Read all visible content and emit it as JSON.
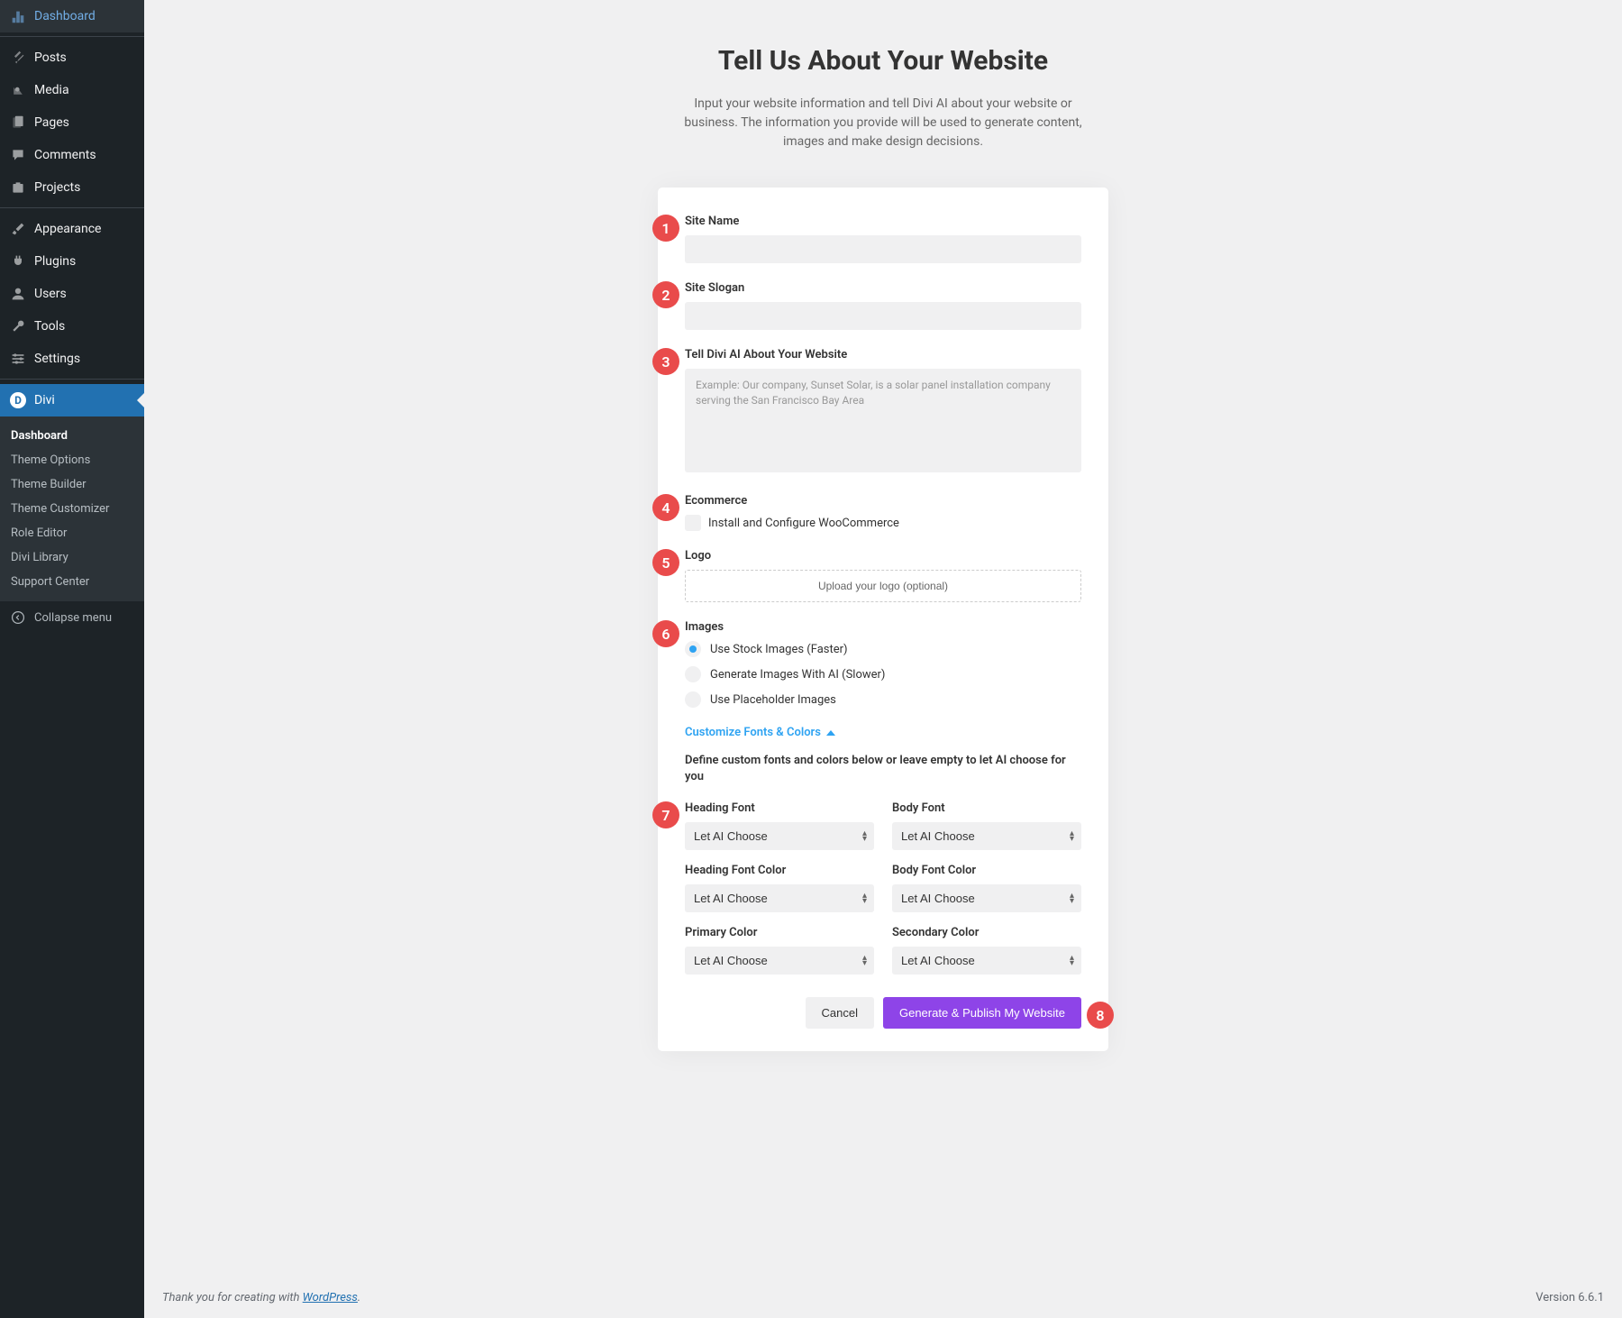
{
  "sidebar": {
    "items": [
      {
        "label": "Dashboard",
        "icon": "dashboard"
      },
      {
        "label": "Posts",
        "icon": "pin"
      },
      {
        "label": "Media",
        "icon": "media"
      },
      {
        "label": "Pages",
        "icon": "pages"
      },
      {
        "label": "Comments",
        "icon": "comment"
      },
      {
        "label": "Projects",
        "icon": "projects"
      }
    ],
    "items2": [
      {
        "label": "Appearance",
        "icon": "brush"
      },
      {
        "label": "Plugins",
        "icon": "plug"
      },
      {
        "label": "Users",
        "icon": "user"
      },
      {
        "label": "Tools",
        "icon": "wrench"
      },
      {
        "label": "Settings",
        "icon": "settings"
      }
    ],
    "divi_label": "Divi",
    "submenu": [
      "Dashboard",
      "Theme Options",
      "Theme Builder",
      "Theme Customizer",
      "Role Editor",
      "Divi Library",
      "Support Center"
    ],
    "collapse": "Collapse menu"
  },
  "page": {
    "title": "Tell Us About Your Website",
    "desc": "Input your website information and tell Divi AI about your website or business. The information you provide will be used to generate content, images and make design decisions."
  },
  "form": {
    "site_name_label": "Site Name",
    "site_slogan_label": "Site Slogan",
    "about_label": "Tell Divi AI About Your Website",
    "about_placeholder": "Example: Our company, Sunset Solar, is a solar panel installation company serving the San Francisco Bay Area",
    "ecommerce_label": "Ecommerce",
    "ecommerce_checkbox": "Install and Configure WooCommerce",
    "logo_label": "Logo",
    "logo_upload": "Upload your logo (optional)",
    "images_label": "Images",
    "images_options": [
      "Use Stock Images (Faster)",
      "Generate Images With AI (Slower)",
      "Use Placeholder Images"
    ],
    "customize_link": "Customize Fonts & Colors",
    "customize_help": "Define custom fonts and colors below or leave empty to let AI choose for you",
    "heading_font_label": "Heading Font",
    "body_font_label": "Body Font",
    "heading_color_label": "Heading Font Color",
    "body_color_label": "Body Font Color",
    "primary_color_label": "Primary Color",
    "secondary_color_label": "Secondary Color",
    "select_default": "Let AI Choose",
    "cancel": "Cancel",
    "generate": "Generate & Publish My Website"
  },
  "badges": [
    "1",
    "2",
    "3",
    "4",
    "5",
    "6",
    "7",
    "8"
  ],
  "footer": {
    "thanks_prefix": "Thank you for creating with ",
    "wp": "WordPress",
    "version": "Version 6.6.1"
  }
}
